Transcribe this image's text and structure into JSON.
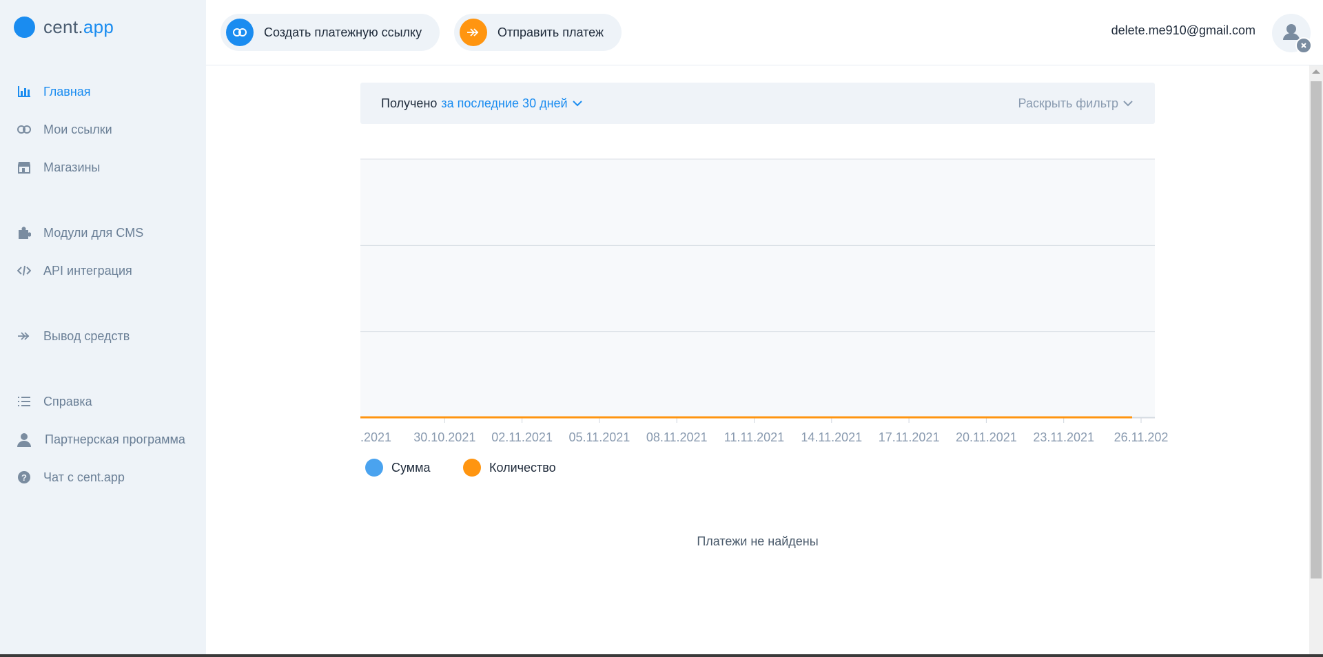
{
  "brand": {
    "name_prefix": "cent.",
    "name_suffix": "app",
    "accent": "#1a8cf0"
  },
  "sidebar": {
    "items": [
      {
        "label": "Главная",
        "icon": "bar-chart-icon",
        "active": true
      },
      {
        "label": "Мои ссылки",
        "icon": "link-icon"
      },
      {
        "label": "Магазины",
        "icon": "store-icon"
      },
      {
        "label": "Модули для CMS",
        "icon": "puzzle-icon"
      },
      {
        "label": "API интеграция",
        "icon": "code-icon"
      },
      {
        "label": "Вывод средств",
        "icon": "double-arrow-icon"
      },
      {
        "label": "Справка",
        "icon": "list-icon"
      },
      {
        "label": "Партнерская программа",
        "icon": "user-icon"
      },
      {
        "label": "Чат с cent.app",
        "icon": "help-icon"
      }
    ]
  },
  "topbar": {
    "create_link_label": "Создать платежную ссылку",
    "send_payment_label": "Отправить платеж",
    "email": "delete.me910@gmail.com"
  },
  "filter": {
    "received_label": "Получено",
    "period_label": "за последние 30 дней",
    "expand_label": "Раскрыть фильтр"
  },
  "chart_data": {
    "type": "line",
    "x": [
      ".2021",
      "30.10.2021",
      "02.11.2021",
      "05.11.2021",
      "08.11.2021",
      "11.11.2021",
      "14.11.2021",
      "17.11.2021",
      "20.11.2021",
      "23.11.2021",
      "26.11.202"
    ],
    "series": [
      {
        "name": "Сумма",
        "color": "#4aa3ef",
        "values": [
          0,
          0,
          0,
          0,
          0,
          0,
          0,
          0,
          0,
          0,
          0
        ]
      },
      {
        "name": "Количество",
        "color": "#ff9510",
        "values": [
          0,
          0,
          0,
          0,
          0,
          0,
          0,
          0,
          0,
          0,
          0
        ]
      }
    ],
    "grid": true,
    "legend": "bottom-left"
  },
  "empty_message": "Платежи не найдены"
}
